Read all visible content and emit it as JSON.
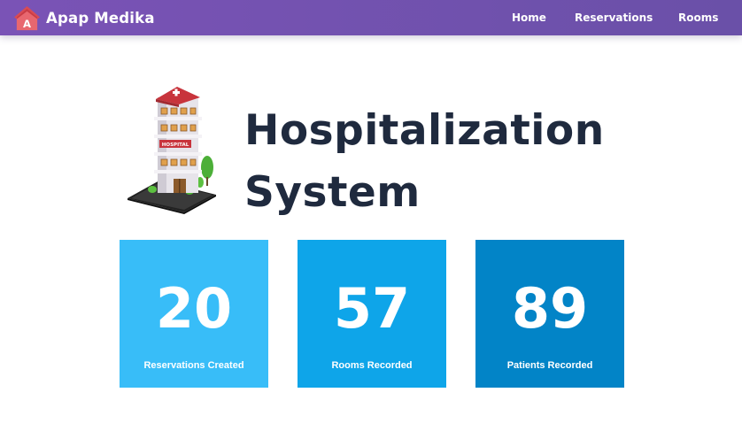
{
  "navbar": {
    "brand_name": "Apap Medika",
    "logo_letter": "A",
    "links": [
      {
        "label": "Home"
      },
      {
        "label": "Reservations"
      },
      {
        "label": "Rooms"
      }
    ]
  },
  "hero": {
    "title_line1": "Hospitalization",
    "title_line2": "System",
    "image_sign": "HOSPITAL"
  },
  "stats": [
    {
      "value": "20",
      "label": "Reservations Created",
      "color": "#38bdf8"
    },
    {
      "value": "57",
      "label": "Rooms Recorded",
      "color": "#0ea5e9"
    },
    {
      "value": "89",
      "label": "Patients Recorded",
      "color": "#0284c7"
    }
  ],
  "colors": {
    "navbar": "#7a53b6",
    "title": "#1f2a3e"
  }
}
